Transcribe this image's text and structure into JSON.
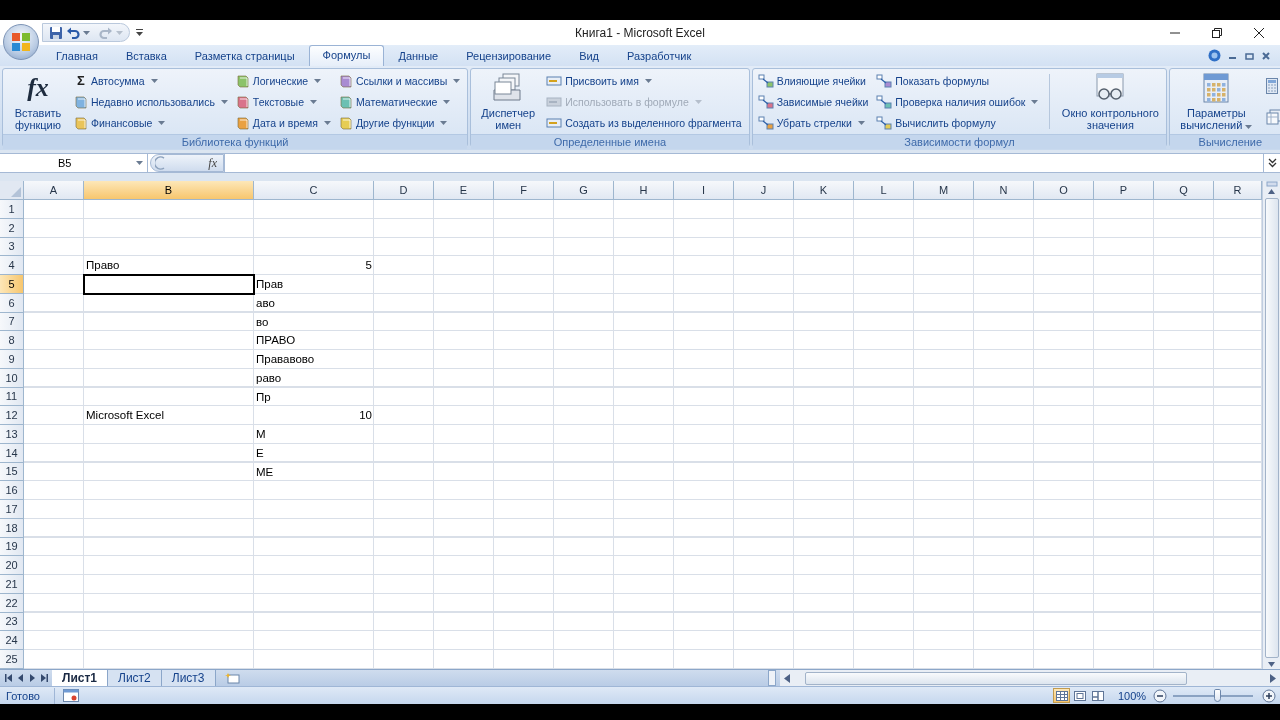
{
  "window": {
    "title": "Книга1 - Microsoft Excel"
  },
  "quick_access": [
    {
      "kind": "save",
      "disabled": false
    },
    {
      "kind": "undo",
      "disabled": false
    },
    {
      "kind": "redo",
      "disabled": true
    }
  ],
  "tabs": [
    {
      "label": "Главная",
      "selected": false
    },
    {
      "label": "Вставка",
      "selected": false
    },
    {
      "label": "Разметка страницы",
      "selected": false
    },
    {
      "label": "Формулы",
      "selected": true
    },
    {
      "label": "Данные",
      "selected": false
    },
    {
      "label": "Рецензирование",
      "selected": false
    },
    {
      "label": "Вид",
      "selected": false
    },
    {
      "label": "Разработчик",
      "selected": false
    }
  ],
  "ribbon_groups": [
    {
      "label": "Библиотека функций",
      "parts": [
        {
          "kind": "large",
          "label": "Вставить функцию",
          "symbol": "fx",
          "dropdown": false
        },
        {
          "kind": "column",
          "items": [
            {
              "label": "Автосумма",
              "symbol": "Σ",
              "dropdown": true,
              "disabled": false
            },
            {
              "label": "Недавно использовались",
              "dropdown": true,
              "disabled": false
            },
            {
              "label": "Финансовые",
              "dropdown": true,
              "disabled": false
            }
          ]
        },
        {
          "kind": "column",
          "items": [
            {
              "label": "Логические",
              "dropdown": true,
              "disabled": false
            },
            {
              "label": "Текстовые",
              "dropdown": true,
              "disabled": false
            },
            {
              "label": "Дата и время",
              "dropdown": true,
              "disabled": false
            }
          ]
        },
        {
          "kind": "column",
          "items": [
            {
              "label": "Ссылки и массивы",
              "dropdown": true,
              "disabled": false
            },
            {
              "label": "Математические",
              "dropdown": true,
              "disabled": false
            },
            {
              "label": "Другие функции",
              "dropdown": true,
              "disabled": false
            }
          ]
        }
      ]
    },
    {
      "label": "Определенные имена",
      "parts": [
        {
          "kind": "large",
          "label": "Диспетчер имен",
          "dropdown": false
        },
        {
          "kind": "column",
          "items": [
            {
              "label": "Присвоить имя",
              "dropdown": true,
              "disabled": false
            },
            {
              "label": "Использовать в формуле",
              "dropdown": true,
              "disabled": true
            },
            {
              "label": "Создать из выделенного фрагмента",
              "dropdown": false,
              "disabled": false
            }
          ]
        }
      ]
    },
    {
      "label": "Зависимости формул",
      "parts": [
        {
          "kind": "column",
          "items": [
            {
              "label": "Влияющие ячейки",
              "dropdown": false,
              "disabled": false
            },
            {
              "label": "Зависимые ячейки",
              "dropdown": false,
              "disabled": false
            },
            {
              "label": "Убрать стрелки",
              "dropdown": true,
              "disabled": false
            }
          ]
        },
        {
          "kind": "column",
          "items": [
            {
              "label": "Показать формулы",
              "dropdown": false,
              "disabled": false
            },
            {
              "label": "Проверка наличия ошибок",
              "dropdown": true,
              "disabled": false
            },
            {
              "label": "Вычислить формулу",
              "dropdown": false,
              "disabled": false
            }
          ]
        },
        {
          "kind": "separator"
        },
        {
          "kind": "large",
          "label": "Окно контрольного значения",
          "dropdown": false
        }
      ]
    },
    {
      "label": "Вычисление",
      "parts": [
        {
          "kind": "large",
          "label": "Параметры вычислений",
          "dropdown": true
        },
        {
          "kind": "icon_column"
        }
      ]
    }
  ],
  "formula_bar": {
    "name_box": "B5",
    "symbol": "fx"
  },
  "columns": [
    {
      "label": "A",
      "selected": false
    },
    {
      "label": "B",
      "selected": true
    },
    {
      "label": "C",
      "selected": false
    },
    {
      "label": "D",
      "selected": false
    },
    {
      "label": "E",
      "selected": false
    },
    {
      "label": "F",
      "selected": false
    },
    {
      "label": "G",
      "selected": false
    },
    {
      "label": "H",
      "selected": false
    },
    {
      "label": "I",
      "selected": false
    },
    {
      "label": "J",
      "selected": false
    },
    {
      "label": "K",
      "selected": false
    },
    {
      "label": "L",
      "selected": false
    },
    {
      "label": "M",
      "selected": false
    },
    {
      "label": "N",
      "selected": false
    },
    {
      "label": "O",
      "selected": false
    },
    {
      "label": "P",
      "selected": false
    },
    {
      "label": "Q",
      "selected": false
    },
    {
      "label": "R",
      "selected": false
    }
  ],
  "rows": [
    {
      "label": "1",
      "selected": false
    },
    {
      "label": "2",
      "selected": false
    },
    {
      "label": "3",
      "selected": false
    },
    {
      "label": "4",
      "selected": false,
      "cells": {
        "B": {
          "text": "Право",
          "kind": "text"
        },
        "C": {
          "text": "5",
          "kind": "number"
        }
      }
    },
    {
      "label": "5",
      "selected": true,
      "cells": {
        "C": {
          "text": "Прав",
          "kind": "text"
        }
      }
    },
    {
      "label": "6",
      "selected": false,
      "cells": {
        "C": {
          "text": "аво",
          "kind": "text"
        }
      }
    },
    {
      "label": "7",
      "selected": false,
      "cells": {
        "C": {
          "text": "во",
          "kind": "text"
        }
      }
    },
    {
      "label": "8",
      "selected": false,
      "cells": {
        "C": {
          "text": "ПРАВО",
          "kind": "text"
        }
      }
    },
    {
      "label": "9",
      "selected": false,
      "cells": {
        "C": {
          "text": "Прававово",
          "kind": "text"
        }
      }
    },
    {
      "label": "10",
      "selected": false,
      "cells": {
        "C": {
          "text": "раво",
          "kind": "text"
        }
      }
    },
    {
      "label": "11",
      "selected": false,
      "cells": {
        "C": {
          "text": "Пр",
          "kind": "text"
        }
      }
    },
    {
      "label": "12",
      "selected": false,
      "cells": {
        "B": {
          "text": "Microsoft Excel",
          "kind": "text"
        },
        "C": {
          "text": "10",
          "kind": "number"
        }
      }
    },
    {
      "label": "13",
      "selected": false,
      "cells": {
        "C": {
          "text": "M",
          "kind": "text"
        }
      }
    },
    {
      "label": "14",
      "selected": false,
      "cells": {
        "C": {
          "text": "E",
          "kind": "text"
        }
      }
    },
    {
      "label": "15",
      "selected": false,
      "cells": {
        "C": {
          "text": "ME",
          "kind": "text"
        }
      }
    },
    {
      "label": "16",
      "selected": false
    },
    {
      "label": "17",
      "selected": false
    },
    {
      "label": "18",
      "selected": false
    },
    {
      "label": "19",
      "selected": false
    },
    {
      "label": "20",
      "selected": false
    },
    {
      "label": "21",
      "selected": false
    },
    {
      "label": "22",
      "selected": false
    },
    {
      "label": "23",
      "selected": false
    },
    {
      "label": "24",
      "selected": false
    },
    {
      "label": "25",
      "selected": false
    }
  ],
  "sheets": [
    {
      "label": "Лист1",
      "selected": true
    },
    {
      "label": "Лист2",
      "selected": false
    },
    {
      "label": "Лист3",
      "selected": false
    }
  ],
  "status_bar": {
    "text": "Готово",
    "views": [
      {
        "kind": "normal",
        "selected": true
      },
      {
        "kind": "layout",
        "selected": false
      },
      {
        "kind": "page_break",
        "selected": false
      }
    ],
    "zoom": "100%",
    "zoom_slider": {
      "level": 0.55
    }
  }
}
